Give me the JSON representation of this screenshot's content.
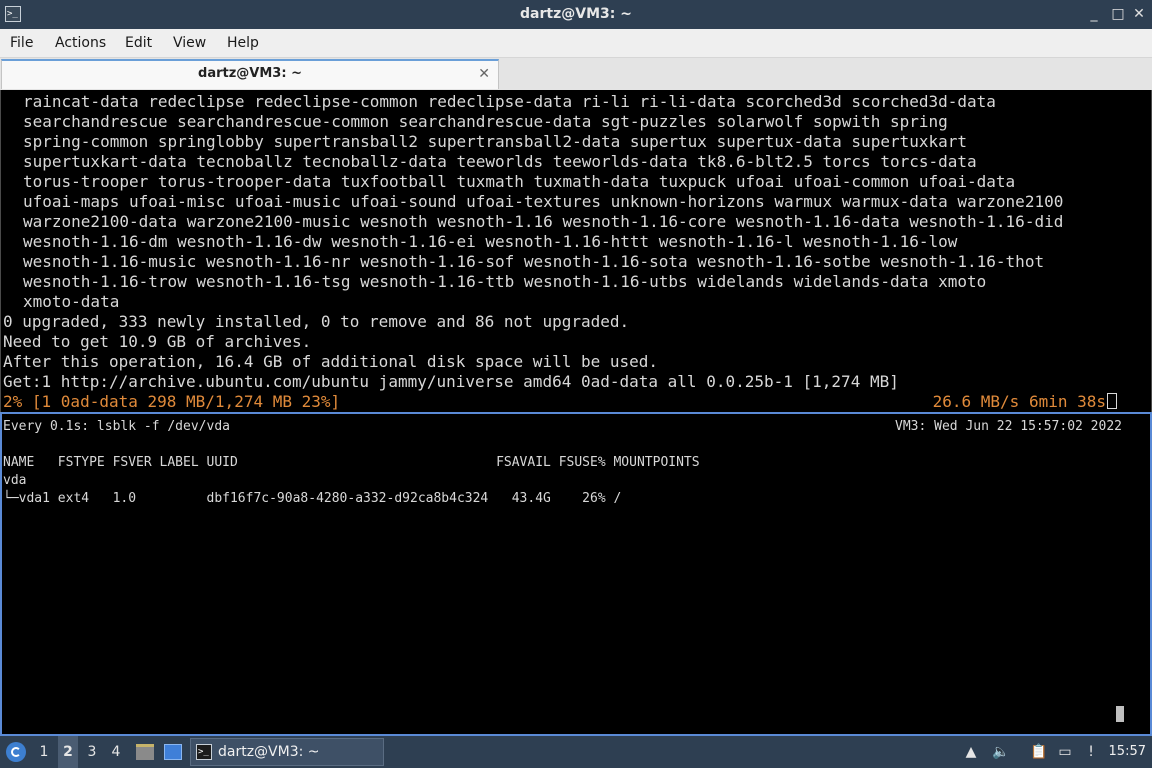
{
  "window": {
    "title": "dartz@VM3: ~",
    "controls": {
      "minimize": "_",
      "maximize": "□",
      "close": "✕"
    }
  },
  "menu": [
    "File",
    "Actions",
    "Edit",
    "View",
    "Help"
  ],
  "tab": {
    "label": "dartz@VM3: ~",
    "close": "✕"
  },
  "terminal_top": {
    "package_lines": [
      "raincat-data redeclipse redeclipse-common redeclipse-data ri-li ri-li-data scorched3d scorched3d-data",
      "searchandrescue searchandrescue-common searchandrescue-data sgt-puzzles solarwolf sopwith spring",
      "spring-common springlobby supertransball2 supertransball2-data supertux supertux-data supertuxkart",
      "supertuxkart-data tecnoballz tecnoballz-data teeworlds teeworlds-data tk8.6-blt2.5 torcs torcs-data",
      "torus-trooper torus-trooper-data tuxfootball tuxmath tuxmath-data tuxpuck ufoai ufoai-common ufoai-data",
      "ufoai-maps ufoai-misc ufoai-music ufoai-sound ufoai-textures unknown-horizons warmux warmux-data warzone2100",
      "warzone2100-data warzone2100-music wesnoth wesnoth-1.16 wesnoth-1.16-core wesnoth-1.16-data wesnoth-1.16-did",
      "wesnoth-1.16-dm wesnoth-1.16-dw wesnoth-1.16-ei wesnoth-1.16-httt wesnoth-1.16-l wesnoth-1.16-low",
      "wesnoth-1.16-music wesnoth-1.16-nr wesnoth-1.16-sof wesnoth-1.16-sota wesnoth-1.16-sotbe wesnoth-1.16-thot",
      "wesnoth-1.16-trow wesnoth-1.16-tsg wesnoth-1.16-ttb wesnoth-1.16-utbs widelands widelands-data xmoto",
      "xmoto-data"
    ],
    "summary_lines": [
      "0 upgraded, 333 newly installed, 0 to remove and 86 not upgraded.",
      "Need to get 10.9 GB of archives.",
      "After this operation, 16.4 GB of additional disk space will be used.",
      "Get:1 http://archive.ubuntu.com/ubuntu jammy/universe amd64 0ad-data all 0.0.25b-1 [1,274 MB]"
    ],
    "progress_left": "2% [1 0ad-data 298 MB/1,274 MB 23%]",
    "progress_right": "26.6 MB/s 6min 38s",
    "progress_percent": 23,
    "colors": {
      "progress": "#e08a3a",
      "text": "#d8d8d8"
    }
  },
  "terminal_bottom": {
    "watch_header": "Every 0.1s: lsblk -f /dev/vda",
    "watch_host_time": "VM3: Wed Jun 22 15:57:02 2022",
    "table_header": "NAME   FSTYPE FSVER LABEL UUID                                 FSAVAIL FSUSE% MOUNTPOINTS",
    "rows": [
      "vda",
      "└─vda1 ext4   1.0         dbf16f7c-90a8-4280-a332-d92ca8b4c324   43.4G    26% /"
    ]
  },
  "taskbar": {
    "workspaces": [
      "1",
      "2",
      "3",
      "4"
    ],
    "active_workspace": "2",
    "task_label": "dartz@VM3: ~",
    "clock": "15:57",
    "tray_icons": [
      "drive-icon",
      "volume-icon",
      "clipboard-icon",
      "network-icon",
      "notification-icon"
    ]
  }
}
